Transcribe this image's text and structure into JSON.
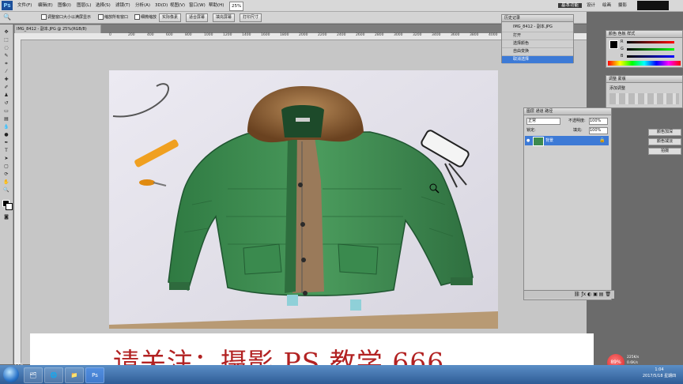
{
  "app": {
    "logo": "Ps",
    "menu": [
      "文件(F)",
      "编辑(E)",
      "图像(I)",
      "图层(L)",
      "选择(S)",
      "滤镜(T)",
      "分析(A)",
      "3D(D)",
      "视图(V)",
      "窗口(W)",
      "帮助(H)"
    ],
    "workspaces": [
      "基本功能",
      "设计",
      "绘画",
      "摄影"
    ],
    "zoom_display": "25%"
  },
  "options_bar": {
    "check1": "调整窗口大小以满屏显示",
    "check2": "缩放所有窗口",
    "check3": "细微缩放",
    "btn1": "实际像素",
    "btn2": "适合屏幕",
    "btn3": "填充屏幕",
    "btn4": "打印尺寸"
  },
  "document": {
    "tab_title": "IMG_8412 - 副本.JPG @ 25%(RGB/8)",
    "ruler_marks": [
      "0",
      "200",
      "400",
      "600",
      "800",
      "1000",
      "1200",
      "1400",
      "1600",
      "1800",
      "2000",
      "2200",
      "2400",
      "2600",
      "2800",
      "3000",
      "3200",
      "3400",
      "3600",
      "3800",
      "4000",
      "4200",
      "4400"
    ],
    "status_zoom": "25%"
  },
  "history_panel": {
    "tab1": "历史记录",
    "snapshot": "IMG_8412 - 副本.JPG",
    "items": [
      "打开",
      "选择颜色",
      "自由变换",
      "取消选择"
    ]
  },
  "layers_panel": {
    "tabs": [
      "图层",
      "通道",
      "路径"
    ],
    "blend_mode": "正常",
    "opacity_label": "不透明度:",
    "opacity": "100%",
    "lock_label": "锁定:",
    "fill_label": "填充:",
    "fill": "100%",
    "layer_name": "背景"
  },
  "color_panel": {
    "tabs": [
      "颜色",
      "色板",
      "样式"
    ],
    "channels": [
      "R",
      "G",
      "B"
    ]
  },
  "adjust_panel": {
    "tabs": [
      "调整",
      "蒙版"
    ],
    "title": "添加调整",
    "buttons": [
      "颜色加深",
      "颜色减淡",
      "拍摄"
    ]
  },
  "caption": {
    "text": "请关注：摄影 PS 教学 666"
  },
  "taskbar": {
    "cpu": "89%",
    "net_up": "225K/s",
    "net_down": "0.6K/s",
    "time": "1:04",
    "date": "2017/5/18 星期四"
  },
  "colors": {
    "jacket_green": "#3d8a4e",
    "fur": "#8a5a30",
    "selection_blue": "#3d7ad6",
    "caption_red": "#b22222"
  }
}
